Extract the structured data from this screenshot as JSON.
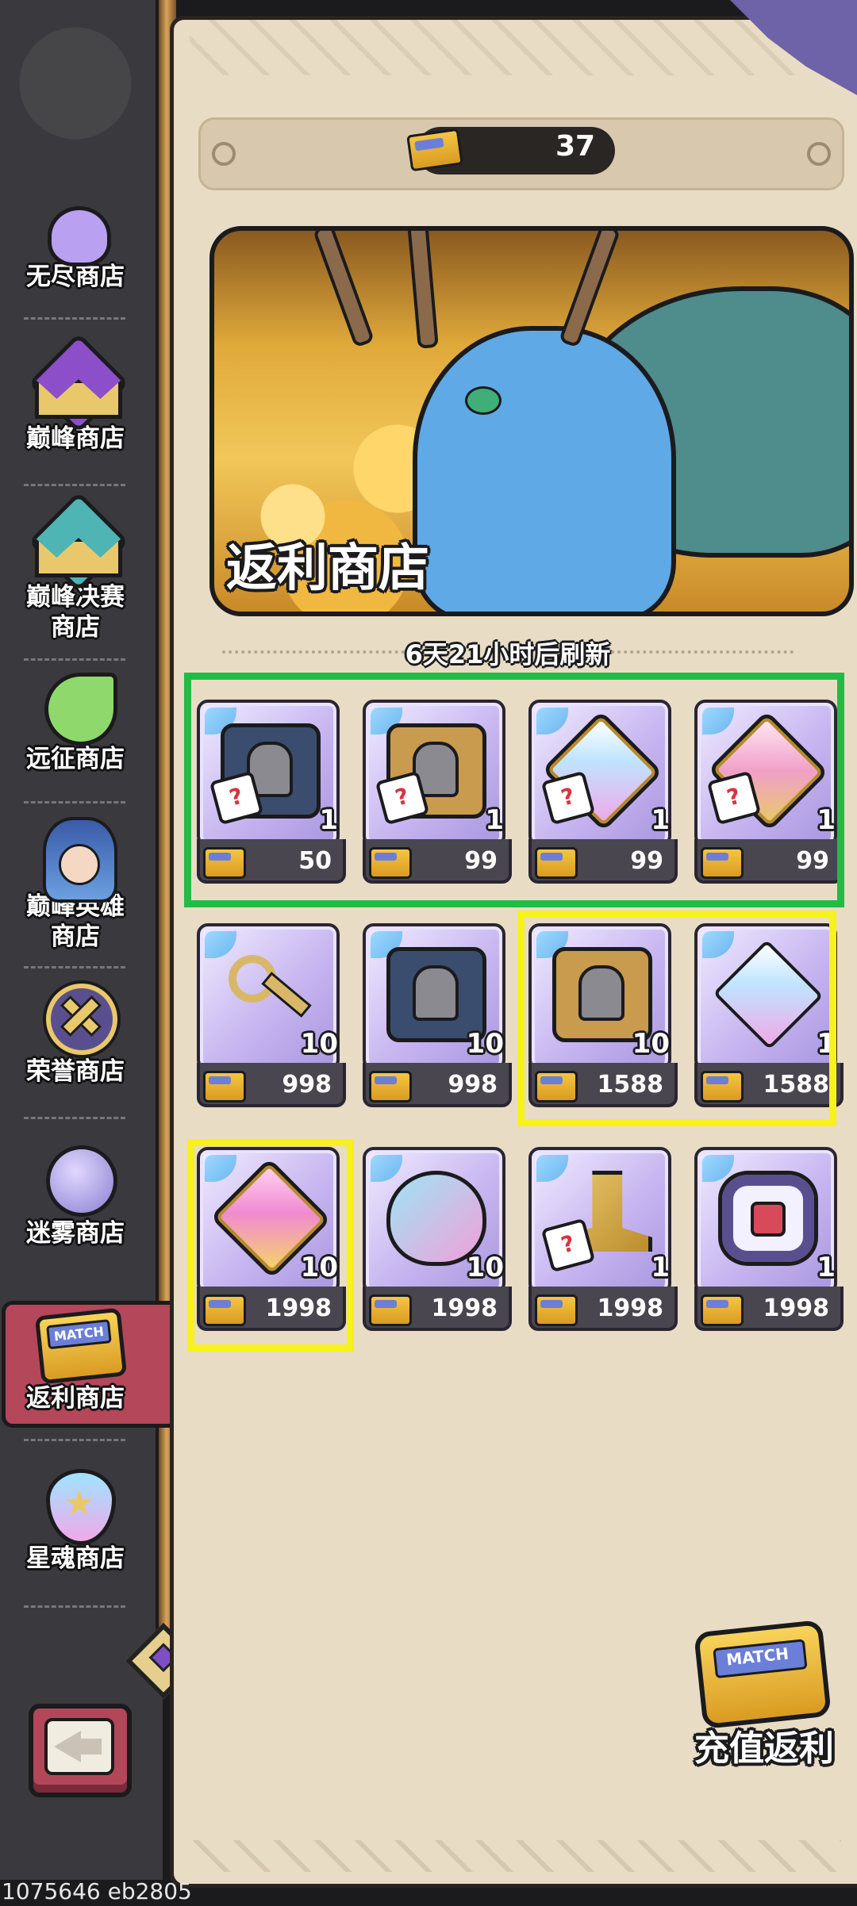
{
  "header": {
    "currency_value": "37",
    "currency_icon": "match-ticket-icon"
  },
  "sidebar": {
    "items": [
      {
        "label": "无尽商店",
        "icon": "slime-icon"
      },
      {
        "label": "巅峰商店",
        "icon": "purple-crown-icon"
      },
      {
        "label": "巅峰决赛商店",
        "icon": "teal-crown-icon"
      },
      {
        "label": "远征商店",
        "icon": "green-slime-icon"
      },
      {
        "label": "巅峰英雄商店",
        "icon": "hero-portrait-icon"
      },
      {
        "label": "荣誉商店",
        "icon": "crossed-swords-icon"
      },
      {
        "label": "迷雾商店",
        "icon": "mist-orb-icon"
      },
      {
        "label": "返利商店",
        "icon": "match-ticket-icon",
        "active": true
      },
      {
        "label": "星魂商店",
        "icon": "star-soul-icon"
      }
    ],
    "back_icon": "back-arrow-icon",
    "active_badge_text": "MATCH"
  },
  "banner": {
    "title": "返利商店"
  },
  "refresh": {
    "text": "6天21小时后刷新"
  },
  "items": [
    {
      "icon": "random-blue-helmet-book-icon",
      "qty": "1",
      "price": "50"
    },
    {
      "icon": "random-gold-helmet-book-icon",
      "qty": "1",
      "price": "99"
    },
    {
      "icon": "random-crystal-icon",
      "qty": "1",
      "price": "99"
    },
    {
      "icon": "random-pink-crystal-icon",
      "qty": "1",
      "price": "99"
    },
    {
      "icon": "gold-key-icon",
      "qty": "10",
      "price": "998"
    },
    {
      "icon": "blue-helmet-book-icon",
      "qty": "10",
      "price": "998"
    },
    {
      "icon": "gold-helmet-book-icon",
      "qty": "10",
      "price": "1588"
    },
    {
      "icon": "crystal-icon",
      "qty": "1",
      "price": "1588"
    },
    {
      "icon": "pink-gold-crystal-icon",
      "qty": "10",
      "price": "1998"
    },
    {
      "icon": "spirit-heart-icon",
      "qty": "10",
      "price": "1998"
    },
    {
      "icon": "ssr-random-weapon-icon",
      "qty": "1",
      "price": "1998"
    },
    {
      "icon": "sigil-icon",
      "qty": "1",
      "price": "1998"
    }
  ],
  "recharge": {
    "label": "充值返利",
    "icon_text": "MATCH"
  },
  "footer": {
    "text": "1075646 eb2805"
  },
  "colors": {
    "highlight_green": "#22bb44",
    "highlight_yellow": "#f6f21a",
    "active_tab": "#b5475a",
    "panel": "#e8dcc5"
  }
}
